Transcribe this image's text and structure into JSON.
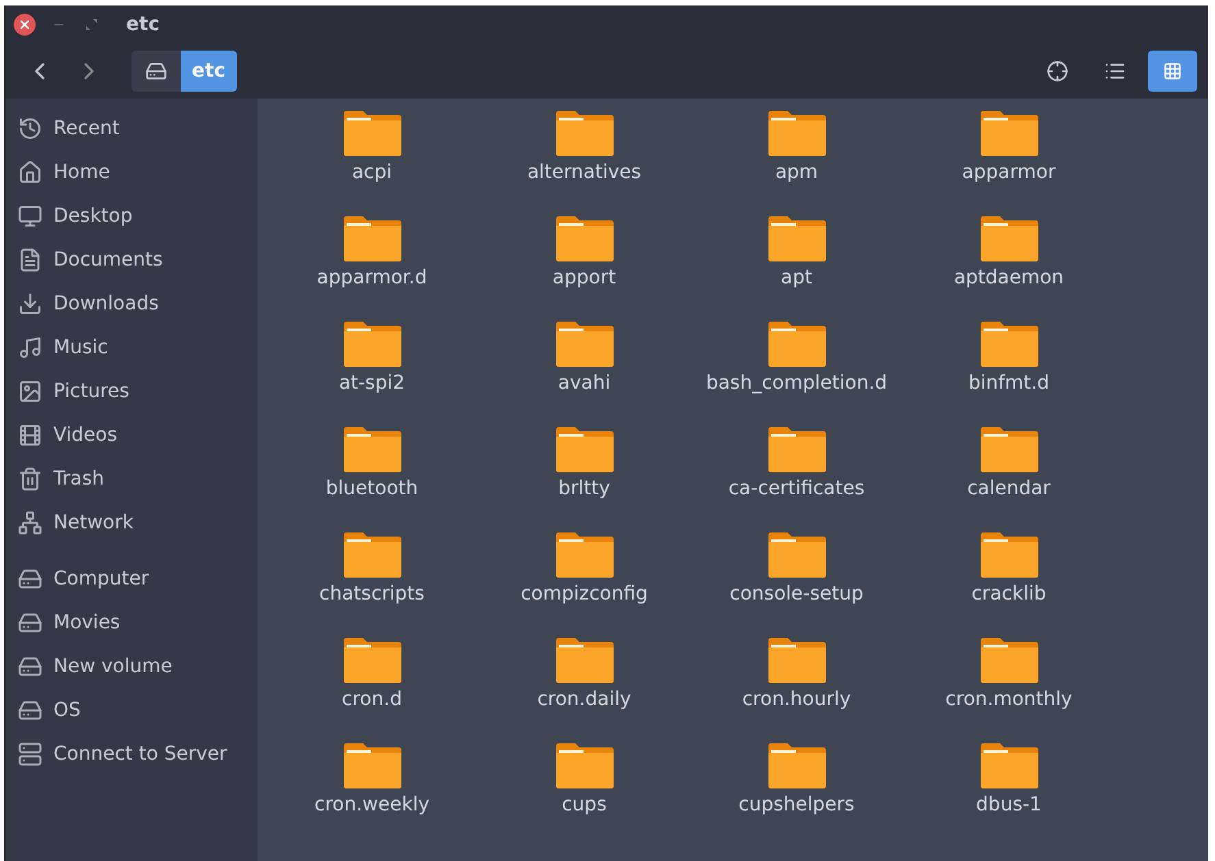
{
  "window": {
    "title": "etc"
  },
  "path_bar": [
    {
      "kind": "drive",
      "selected": false
    },
    {
      "kind": "folder",
      "label": "etc",
      "selected": true
    }
  ],
  "view_buttons": [
    {
      "kind": "list",
      "selected": false
    },
    {
      "kind": "grid",
      "selected": true
    }
  ],
  "sidebar": {
    "groups": [
      {
        "items": [
          "Recent",
          "Home",
          "Desktop",
          "Documents",
          "Downloads",
          "Music",
          "Pictures",
          "Videos",
          "Trash",
          "Network"
        ]
      },
      {
        "items": [
          "Computer",
          "Movies",
          "New volume",
          "OS",
          "Connect to Server"
        ]
      }
    ]
  },
  "folders": [
    "acpi",
    "alternatives",
    "apm",
    "apparmor",
    "apparmor.d",
    "apport",
    "apt",
    "aptdaemon",
    "at-spi2",
    "avahi",
    "bash_completion.d",
    "binfmt.d",
    "bluetooth",
    "brltty",
    "ca-certificates",
    "calendar",
    "chatscripts",
    "compizconfig",
    "console-setup",
    "cracklib",
    "cron.d",
    "cron.daily",
    "cron.hourly",
    "cron.monthly",
    "cron.weekly",
    "cups",
    "cupshelpers",
    "dbus-1"
  ]
}
